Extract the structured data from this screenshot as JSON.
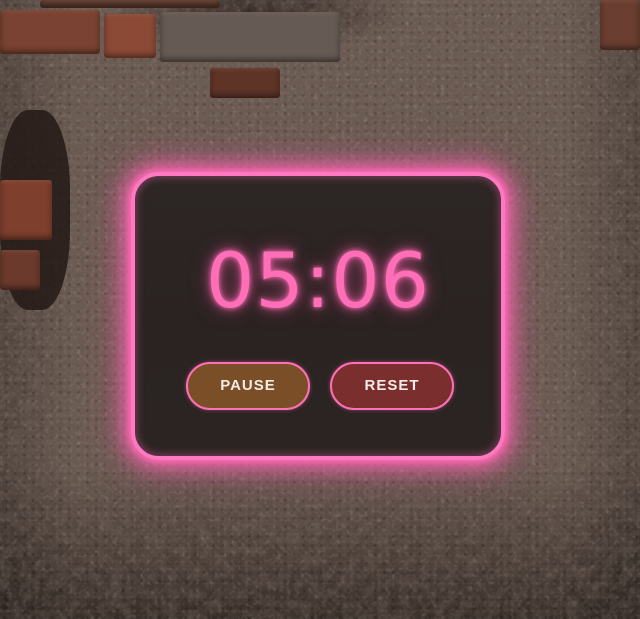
{
  "timer": {
    "display": "05:06",
    "pause_label": "PAUSE",
    "reset_label": "RESET"
  },
  "colors": {
    "neon_accent": "#ff6fb8",
    "panel_background": "#2b2422",
    "pause_button": "#7a4f28",
    "reset_button": "#7b2e2e",
    "button_text": "#f3ebe4"
  }
}
